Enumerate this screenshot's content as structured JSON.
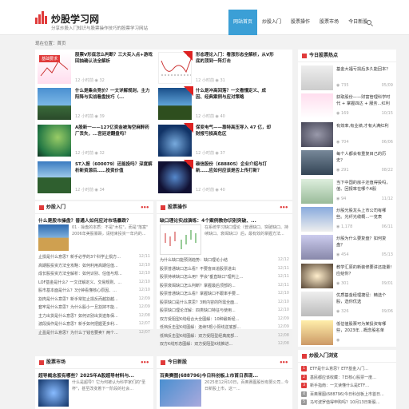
{
  "header": {
    "site_name": "炒股学习网",
    "slogan": "分享炒股入门知识与股票操作技巧的股票学习网站",
    "nav": [
      "网站首页",
      "炒股入门",
      "股票操作",
      "股票市场",
      "今日新股"
    ],
    "nav_active": 0
  },
  "breadcrumb": "现在位置：首页",
  "featured_tag": "基础要求",
  "featured": [
    {
      "title": "股票V形底怎么判断？三大买入点+游戏回抽确认法全解析",
      "meta": "12 小时前 ◉ 32"
    },
    {
      "title": "形态理论入门：看涨形态全解析，从V形底的顶到一阵打击",
      "meta": "12 小时前 ◉ 31"
    },
    {
      "title": "什么是集合竞价？一文详解规则，主力阳降与实战看盘技巧（...",
      "meta": "12 小时前 ◉ 39"
    },
    {
      "title": "什么是冲高回落？一文看懂定义、成因、经典案例与应对策略",
      "meta": "12 小时前 ◉ 40"
    },
    {
      "title": "A股新一——127亿资金被淘空麻醉药厂丢失，...宫廷逆翻盘吗？",
      "meta": "12 小时前 ◉ 32"
    },
    {
      "title": "保变电气——靠特高压导入 47 亿，却财报亏损高危区",
      "meta": "12 小时前 ◉ 37"
    },
    {
      "title": "ST入报（600079）还能投吗？深度解析新资源后……投资价值",
      "meta": "12 小时前 ◉ 34"
    },
    {
      "title": "碳信股份（688805）企业介绍与打新……应如何应该是否上传打新？",
      "meta": "12 小时前 ◉ 40"
    }
  ],
  "sec_rumen": {
    "title": "炒股入门",
    "feat_title": "什么是股市操盘？普通人如何应对市场暴跌？",
    "feat_desc": "01 · 操盘的本质：不是\"木柱\"，而是\"落富\" 2006年美股暴跌，请结束投资一年内的...",
    "rows": [
      [
        "止损是什么意思？新手必学的3个科学止损方...",
        "12/11"
      ],
      [
        "高期股投资方法全攻略：如何利用高期估值...",
        "12/10"
      ],
      [
        "成长股投资方法全解析：如何识别、估值与规...",
        "12/10"
      ],
      [
        "LOF基金是什么？一文详解定义、交易规则、...",
        "12/10"
      ],
      [
        "股市基本面是什么？3分钟看懂核心原因、...",
        "12/10"
      ],
      [
        "割肉是什么意思？新手常犯止损反而越割越...",
        "12/09"
      ],
      [
        "套牢是什么意思？为什么股小一旦割掉不能...",
        "12/09"
      ],
      [
        "主力出货是什么意思？如何识别出货迹象保...",
        "12/08"
      ],
      [
        "波段操作是什么意思？新手如何把握更多利...",
        "12/07"
      ],
      [
        "止盈是什么意思？为什么了钱也要卖？两个...",
        "12/07"
      ]
    ]
  },
  "sec_caozuo": {
    "title": "股票操作",
    "feat_title": "缺口理论实战演练：4个案例教你识别突破、...",
    "feat_desc": "在系统学习缺口理论（普通缺口、突破缺口、持续缺口、衰竭缺口）后，最有效的掌握方法...",
    "rows": [
      [
        "为什么缺口能预测趋势：缺口理论小结",
        "12/12"
      ],
      [
        "股票普通缺口怎么看？不要盲目追股票进出",
        "12/11"
      ],
      [
        "股票持续缺口怎么用？学会\"垂直缺口\"理判上...",
        "12/11"
      ],
      [
        "股票衰竭缺口怎么判断？掌握最后顶部的...",
        "12/11"
      ],
      [
        "股票普通缺口怎么看？掌握缺口不跟率手要...",
        "12/10"
      ],
      [
        "股票缺口是什么意思？3到内容的所需全面...",
        "12/10"
      ],
      [
        "股票缺口理论详解：四类缺口特征与使用...",
        "12/10"
      ],
      [
        "双方受阻型K线组合大全图解：10种最新经...",
        "12/09"
      ],
      [
        "低档反击型K线图解：连续5根小阳线逆底部...",
        "12/09"
      ],
      [
        "低档反击型K线图解：双方受阻型经典底部...",
        "12/08"
      ],
      [
        "双方K线形态图解：双方受阻型K线推进...",
        "12/08"
      ]
    ]
  },
  "sec_shichang": {
    "title": "股票市场",
    "feat_title": "超导概念股有哪些？2025年A股超导材料与...",
    "feat_desc": "什么是超导？它为何被认为科学家们的\"圣杯\"，甚至改变着下一阶段的社会..."
  },
  "sec_xingu": {
    "title": "今日新股",
    "feat_title": "百奥赛图(688796)今日科创板上市首日表现...",
    "feat_desc": "2025年12月10日，百奥赛图股份有限公司...今日新股上市，这一..."
  },
  "side_hot": {
    "title": "今日股票热点",
    "items": [
      {
        "title": "基金大福亏损后多久能回本？",
        "count": "735",
        "date": "05/09"
      },
      {
        "title": "获取股份——财富管理科学时代 + 掌握四达 + 服务...红利",
        "count": "169",
        "date": "10/15"
      },
      {
        "title": "有效率,有业绩,才有大满红利",
        "count": "704",
        "date": "06/06"
      },
      {
        "title": "每个人都会有重复目己的历史？",
        "count": "291",
        "date": "08/22"
      },
      {
        "title": "当下中国的房子还值得投吗，值、回报率在哪个A股",
        "count": "94",
        "date": "11/12"
      },
      {
        "title": "炒股光股龙头上市公司有哪些。光纤光缆概…一览表",
        "count": "1,178",
        "date": "06/11"
      },
      {
        "title": "炒股为什么要复盘？如何复盘？",
        "count": "454",
        "date": "05/13"
      },
      {
        "title": "教学汇原的新装修要讲还能量!应给你？",
        "count": "301",
        "date": "09/01"
      },
      {
        "title": "优质基金经理捷径：精选个股，选你优选",
        "count": "326",
        "date": "09/06"
      },
      {
        "title": "低估值股票可为某投资有哪些，2023年…概念股名单",
        "count": "",
        "date": ""
      }
    ]
  },
  "side_list": {
    "title": "炒股入门浏览",
    "items": [
      "ETF是什么意思？ETF基金入门...",
      "基民都应该收藏：7日核心股票一度…",
      "新手指南：一文读懂什么是ETF…",
      "百奥赛图(688796)今日科创板上市首日...",
      "马可波罗值得申购吗？10月13日新股..."
    ]
  }
}
